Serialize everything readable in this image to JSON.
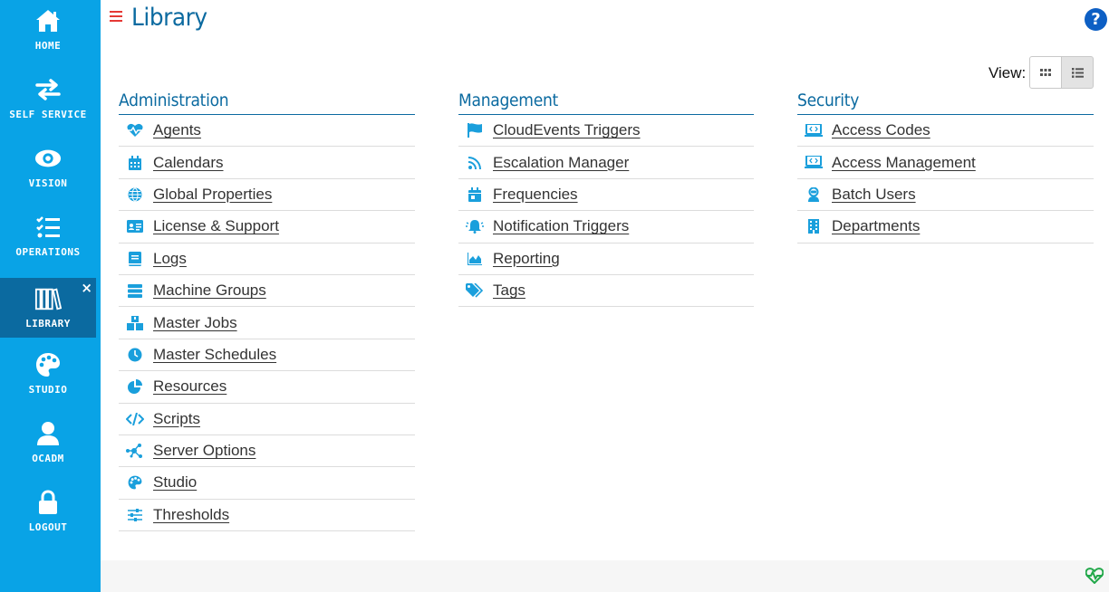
{
  "sidebar": {
    "items": [
      {
        "label": "HOME",
        "icon": "home-icon"
      },
      {
        "label": "SELF SERVICE",
        "icon": "arrows-exchange-icon"
      },
      {
        "label": "VISION",
        "icon": "eye-icon"
      },
      {
        "label": "OPERATIONS",
        "icon": "checklist-icon"
      },
      {
        "label": "LIBRARY",
        "icon": "library-icon",
        "active": true,
        "close": "×"
      },
      {
        "label": "STUDIO",
        "icon": "palette-icon"
      },
      {
        "label": "OCADM",
        "icon": "user-icon"
      },
      {
        "label": "LOGOUT",
        "icon": "lock-icon"
      }
    ]
  },
  "header": {
    "title": "Library",
    "help": "?"
  },
  "view": {
    "label": "View:"
  },
  "columns": [
    {
      "title": "Administration",
      "links": [
        {
          "label": "Agents",
          "icon": "heartbeat-icon"
        },
        {
          "label": "Calendars",
          "icon": "calendar-icon"
        },
        {
          "label": "Global Properties",
          "icon": "globe-icon"
        },
        {
          "label": "License & Support",
          "icon": "id-card-icon"
        },
        {
          "label": "Logs",
          "icon": "book-icon"
        },
        {
          "label": "Machine Groups",
          "icon": "server-icon"
        },
        {
          "label": "Master Jobs",
          "icon": "cubes-icon"
        },
        {
          "label": "Master Schedules",
          "icon": "clock-icon"
        },
        {
          "label": "Resources",
          "icon": "pie-chart-icon"
        },
        {
          "label": "Scripts",
          "icon": "code-icon"
        },
        {
          "label": "Server Options",
          "icon": "network-icon"
        },
        {
          "label": "Studio",
          "icon": "palette-icon"
        },
        {
          "label": "Thresholds",
          "icon": "sliders-icon"
        }
      ]
    },
    {
      "title": "Management",
      "links": [
        {
          "label": "CloudEvents Triggers",
          "icon": "flag-icon"
        },
        {
          "label": "Escalation Manager",
          "icon": "rss-icon"
        },
        {
          "label": "Frequencies",
          "icon": "calendar-icon"
        },
        {
          "label": "Notification Triggers",
          "icon": "bell-icon"
        },
        {
          "label": "Reporting",
          "icon": "area-chart-icon"
        },
        {
          "label": "Tags",
          "icon": "tags-icon"
        }
      ]
    },
    {
      "title": "Security",
      "links": [
        {
          "label": "Access Codes",
          "icon": "laptop-code-icon"
        },
        {
          "label": "Access Management",
          "icon": "laptop-code-icon"
        },
        {
          "label": "Batch Users",
          "icon": "user-robot-icon"
        },
        {
          "label": "Departments",
          "icon": "building-icon"
        }
      ]
    }
  ],
  "colors": {
    "sidebar": "#09a3e6",
    "sidebar_active": "#0b6aa0",
    "accent": "#0b6aa0",
    "icon": "#1a9fdc",
    "menu_toggle": "#e53935",
    "heartbeat": "#22a84a"
  }
}
